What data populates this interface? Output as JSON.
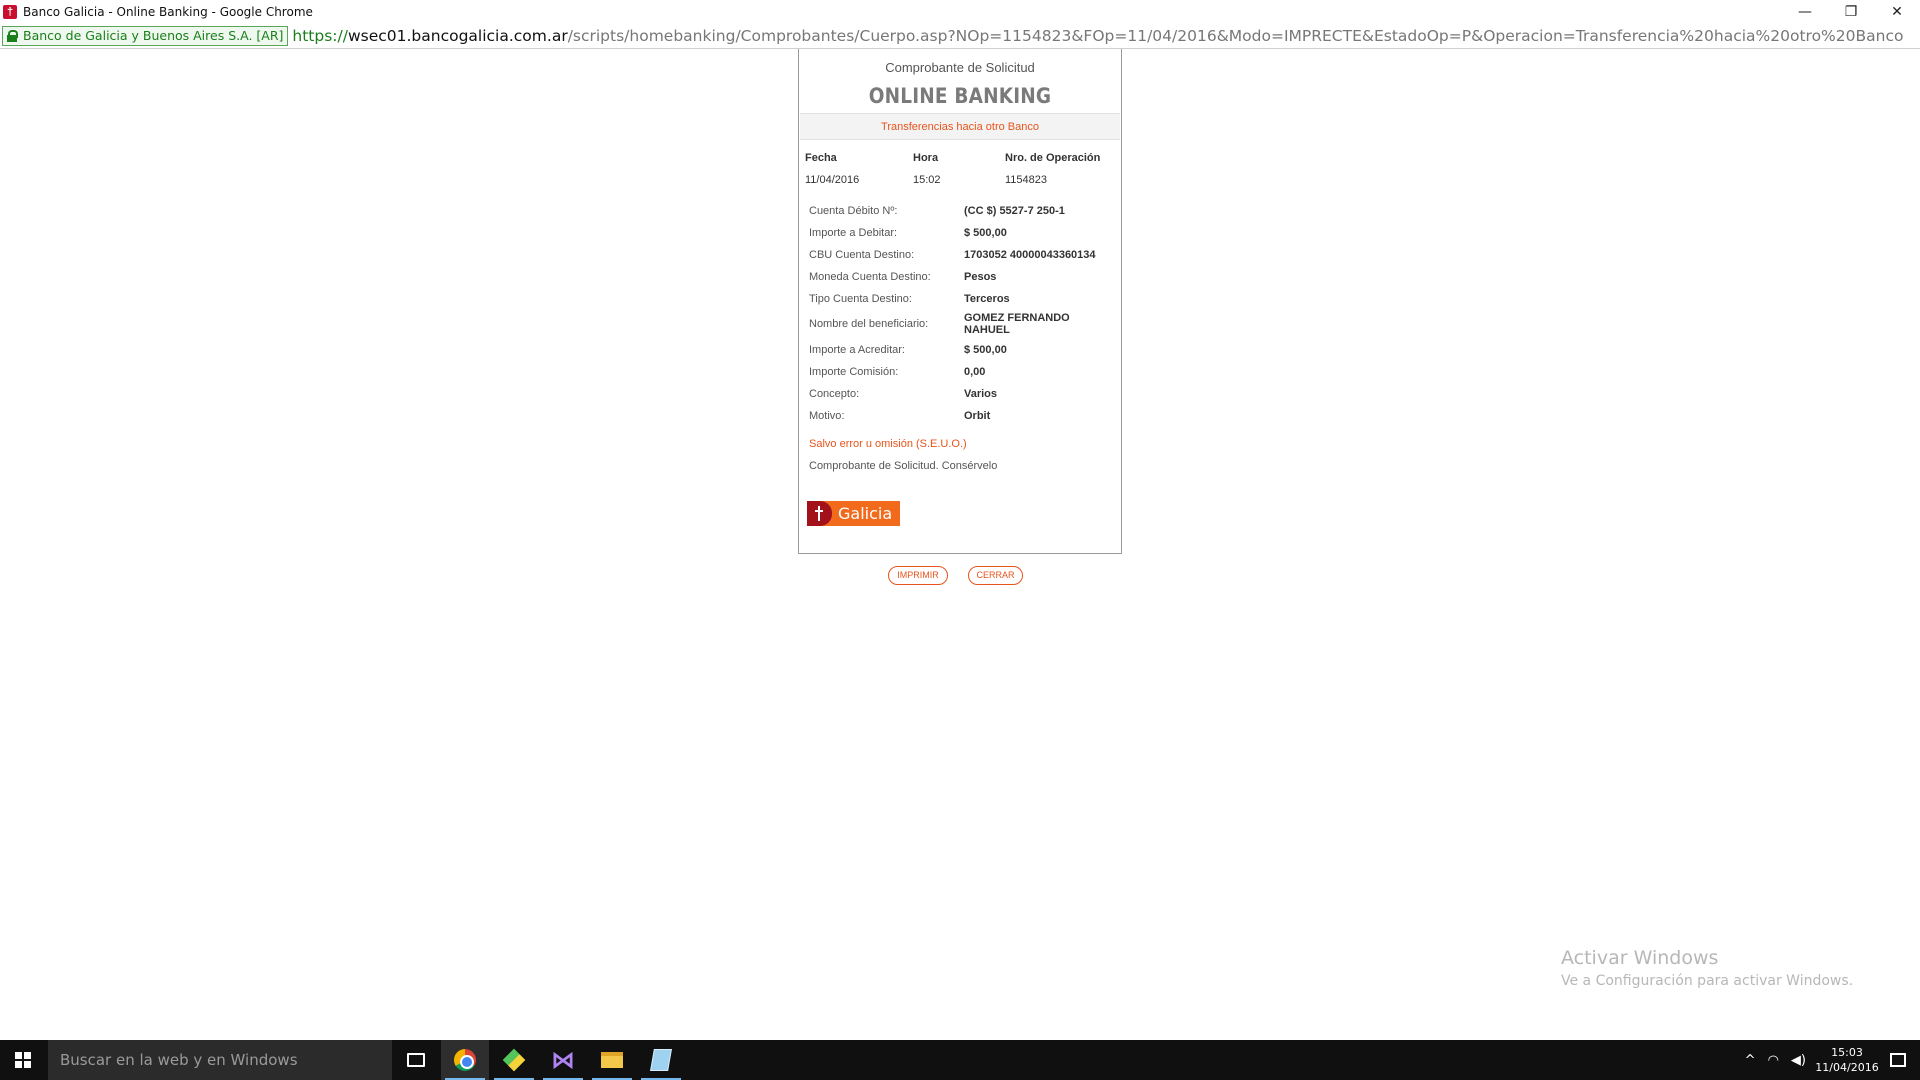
{
  "window": {
    "title": "Banco Galicia - Online Banking - Google Chrome",
    "app_icon": "galicia-favicon",
    "controls": {
      "minimize": "—",
      "restore": "❐",
      "close": "✕"
    }
  },
  "address_bar": {
    "ev_badge": "Banco de Galicia y Buenos Aires S.A. [AR]",
    "url_scheme": "https://",
    "url_host": "wsec01.bancogalicia.com.ar",
    "url_rest": "/scripts/homebanking/Comprobantes/Cuerpo.asp?NOp=1154823&FOp=11/04/2016&Modo=IMPRECTE&EstadoOp=P&Operacion=Transferencia%20hacia%20otro%20Banco"
  },
  "receipt": {
    "subtitle": "Comprobante de Solicitud",
    "title": "ONLINE BANKING",
    "operation_type": "Transferencias hacia otro Banco",
    "meta": {
      "fecha_label": "Fecha",
      "hora_label": "Hora",
      "nro_label": "Nro. de Operación",
      "fecha": "11/04/2016",
      "hora": "15:02",
      "nro": "1154823"
    },
    "details": [
      {
        "label": "Cuenta Débito Nº:",
        "value": "(CC $) 5527-7 250-1"
      },
      {
        "label": "Importe a Debitar:",
        "value": "$ 500,00"
      },
      {
        "label": "CBU Cuenta Destino:",
        "value": "1703052 40000043360134"
      },
      {
        "label": "Moneda Cuenta Destino:",
        "value": "Pesos"
      },
      {
        "label": "Tipo Cuenta Destino:",
        "value": "Terceros"
      },
      {
        "label": "Nombre del beneficiario:",
        "value": "GOMEZ FERNANDO NAHUEL"
      },
      {
        "label": "Importe a Acreditar:",
        "value": "$ 500,00"
      },
      {
        "label": "Importe Comisión:",
        "value": "0,00"
      },
      {
        "label": "Concepto:",
        "value": "Varios"
      },
      {
        "label": "Motivo:",
        "value": "Orbit"
      }
    ],
    "seuo": "Salvo error u omisión (S.E.U.O.)",
    "keep_note": "Comprobante de Solicitud. Consérvelo",
    "logo_text": "Galicia"
  },
  "buttons": {
    "print": "IMPRIMIR",
    "close": "CERRAR"
  },
  "watermark": {
    "line1": "Activar Windows",
    "line2": "Ve a Configuración para activar Windows."
  },
  "taskbar": {
    "search_placeholder": "Buscar en la web y en Windows",
    "apps": [
      "task-view-icon",
      "chrome-icon",
      "git-icon",
      "visual-studio-icon",
      "file-explorer-icon",
      "notepad-icon"
    ],
    "time": "15:03",
    "date": "11/04/2016"
  },
  "colors": {
    "accent_orange": "#e8541c",
    "galicia_red": "#a3121a",
    "galicia_orange": "#f26b1d",
    "ev_green": "#1a7f1a"
  }
}
